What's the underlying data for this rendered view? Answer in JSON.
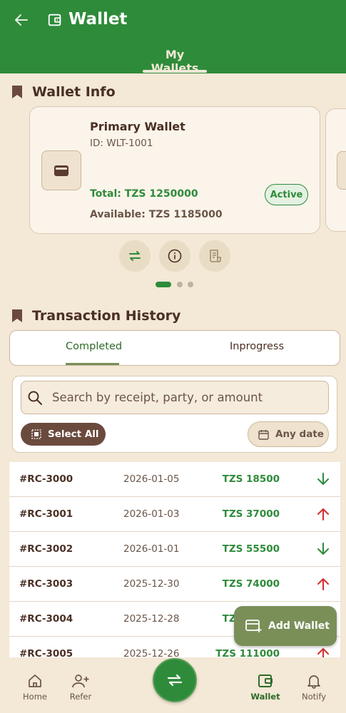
{
  "header": {
    "title": "Wallet",
    "tab": "My Wallets"
  },
  "wallet_info": {
    "heading": "Wallet Info",
    "card": {
      "name": "Primary Wallet",
      "id": "ID: WLT-1001",
      "total": "Total: TZS 1250000",
      "available": "Available: TZS 1185000",
      "status": "Active"
    }
  },
  "transactions": {
    "heading": "Transaction History",
    "tabs": [
      "Completed",
      "Inprogress"
    ],
    "search_placeholder": "Search by receipt, party, or amount",
    "select_all": "Select All",
    "date_filter": "Any date",
    "rows": [
      {
        "id": "#RC-3000",
        "date": "2026-01-05",
        "amount": "TZS 18500",
        "direction": "in"
      },
      {
        "id": "#RC-3001",
        "date": "2026-01-03",
        "amount": "TZS 37000",
        "direction": "out"
      },
      {
        "id": "#RC-3002",
        "date": "2026-01-01",
        "amount": "TZS 55500",
        "direction": "in"
      },
      {
        "id": "#RC-3003",
        "date": "2025-12-30",
        "amount": "TZS 74000",
        "direction": "out"
      },
      {
        "id": "#RC-3004",
        "date": "2025-12-28",
        "amount": "TZS 92500",
        "direction": "in"
      },
      {
        "id": "#RC-3005",
        "date": "2025-12-26",
        "amount": "TZS 111000",
        "direction": "out"
      }
    ]
  },
  "fab": {
    "label": "Add Wallet"
  },
  "nav": {
    "home": "Home",
    "refer": "Refer",
    "wallet": "Wallet",
    "notify": "Notify"
  },
  "colors": {
    "primary": "#2e8b3a",
    "background": "#f4e8d6",
    "brown": "#6b4a3e",
    "olive": "#7a8f58",
    "out_arrow": "#d32f2f"
  }
}
